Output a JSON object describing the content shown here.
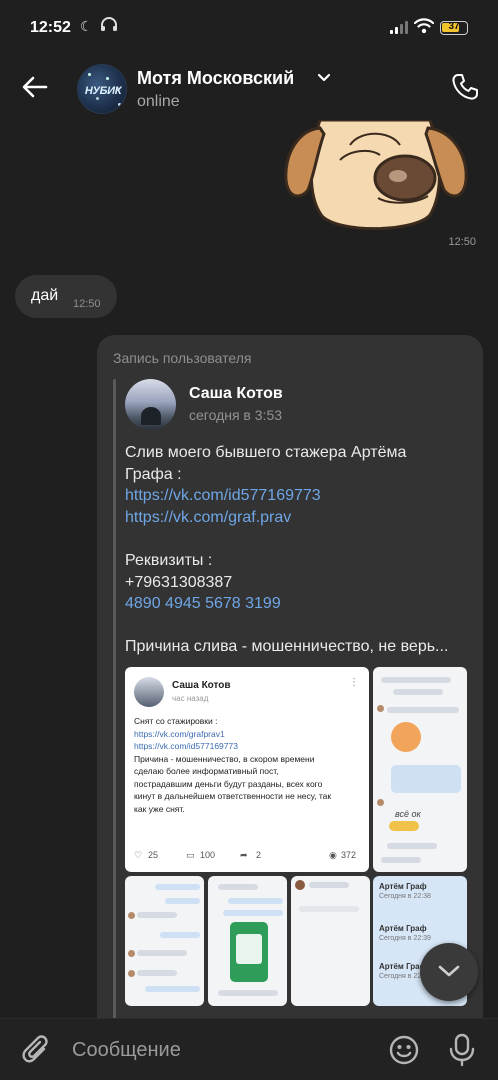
{
  "status_bar": {
    "time": "12:52",
    "battery": "37"
  },
  "header": {
    "name": "Мотя Московский",
    "status": "online",
    "avatar_text": "НУБИК"
  },
  "messages": {
    "sticker_time": "12:50",
    "incoming": {
      "text": "дай",
      "time": "12:50"
    }
  },
  "post": {
    "label": "Запись пользователя",
    "author": "Саша Котов",
    "time": "сегодня в 3:53",
    "lines": [
      "Слив моего бывшего стажера Артёма",
      "Графа :",
      "https://vk.com/id577169773",
      "https://vk.com/graf.prav",
      "",
      "Реквизиты :",
      "+79631308387",
      "4890 4945 5678 3199",
      "",
      "Причина слива - мошенничество, не верь..."
    ],
    "screenshot": {
      "author": "Саша Котов",
      "time": "час назад",
      "lines": [
        "Снят со стажировки :",
        "https://vk.com/grafprav1",
        "https://vk.com/id577169773",
        "",
        "Причина - мошенничество, в скором времени",
        "сделаю более информативный пост,",
        "пострадавшим деньги будут разданы, всех кого",
        "кинут в дальнейшем ответственности не несу, так",
        "как уже снят."
      ],
      "likes": "25",
      "comments": "100",
      "shares": "2",
      "views": "372"
    },
    "side_shot": {
      "sticker_text": "всё ок"
    },
    "blue_shot": {
      "entries": [
        {
          "name": "Артём Граф",
          "time": "Сегодня в 22:38"
        },
        {
          "name": "Артём Граф",
          "time": "Сегодня в 22:39"
        },
        {
          "name": "Артём Граф",
          "time": "Сегодня в 22:41"
        }
      ]
    }
  },
  "input": {
    "placeholder": "Сообщение"
  },
  "colors": {
    "background": "#1f1f1f",
    "bubble": "#333333",
    "link": "#6fa6e6",
    "battery": "#f2c32c"
  },
  "icons": [
    "back-arrow-icon",
    "chevron-down-icon",
    "phone-icon",
    "paperclip-icon",
    "emoji-icon",
    "microphone-icon",
    "scroll-down-icon",
    "moon-icon",
    "headphones-icon",
    "signal-icon",
    "wifi-icon",
    "battery-icon"
  ]
}
